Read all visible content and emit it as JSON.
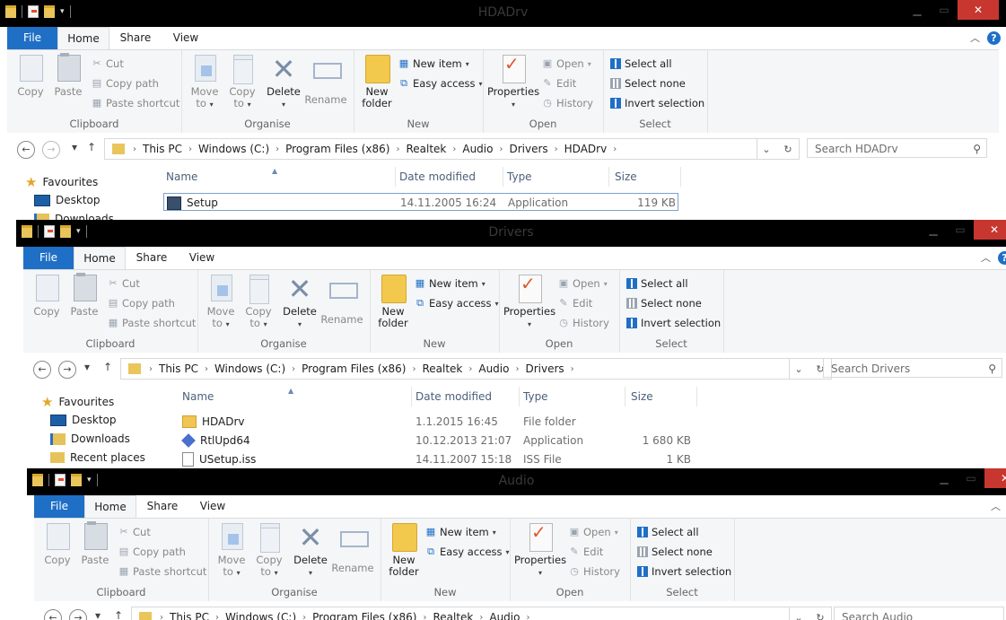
{
  "windows": [
    {
      "title": "HDADrv",
      "tabs": {
        "file": "File",
        "home": "Home",
        "share": "Share",
        "view": "View"
      },
      "ribbon": {
        "clipboard": {
          "label": "Clipboard",
          "copy": "Copy",
          "paste": "Paste",
          "cut": "Cut",
          "copy_path": "Copy path",
          "paste_shortcut": "Paste shortcut"
        },
        "organise": {
          "label": "Organise",
          "move_to": "Move to",
          "copy_to": "Copy to",
          "delete": "Delete",
          "rename": "Rename"
        },
        "new": {
          "label": "New",
          "new_folder": "New folder",
          "new_item": "New item",
          "easy_access": "Easy access"
        },
        "open": {
          "label": "Open",
          "properties": "Properties",
          "open": "Open",
          "edit": "Edit",
          "history": "History"
        },
        "select": {
          "label": "Select",
          "select_all": "Select all",
          "select_none": "Select none",
          "invert_selection": "Invert selection"
        }
      },
      "breadcrumbs": [
        "This PC",
        "Windows (C:)",
        "Program Files (x86)",
        "Realtek",
        "Audio",
        "Drivers",
        "HDADrv"
      ],
      "search_placeholder": "Search HDADrv",
      "nav": {
        "favourites": "Favourites",
        "desktop": "Desktop",
        "downloads": "Downloads"
      },
      "columns": {
        "name": "Name",
        "date": "Date modified",
        "type": "Type",
        "size": "Size"
      },
      "files": [
        {
          "name": "Setup",
          "date": "14.11.2005 16:24",
          "type": "Application",
          "size": "119 KB",
          "icon": "application-icon"
        }
      ]
    },
    {
      "title": "Drivers",
      "tabs": {
        "file": "File",
        "home": "Home",
        "share": "Share",
        "view": "View"
      },
      "ribbon": {
        "clipboard": {
          "label": "Clipboard",
          "copy": "Copy",
          "paste": "Paste",
          "cut": "Cut",
          "copy_path": "Copy path",
          "paste_shortcut": "Paste shortcut"
        },
        "organise": {
          "label": "Organise",
          "move_to": "Move to",
          "copy_to": "Copy to",
          "delete": "Delete",
          "rename": "Rename"
        },
        "new": {
          "label": "New",
          "new_folder": "New folder",
          "new_item": "New item",
          "easy_access": "Easy access"
        },
        "open": {
          "label": "Open",
          "properties": "Properties",
          "open": "Open",
          "edit": "Edit",
          "history": "History"
        },
        "select": {
          "label": "Select",
          "select_all": "Select all",
          "select_none": "Select none",
          "invert_selection": "Invert selection"
        }
      },
      "breadcrumbs": [
        "This PC",
        "Windows (C:)",
        "Program Files (x86)",
        "Realtek",
        "Audio",
        "Drivers"
      ],
      "search_placeholder": "Search Drivers",
      "nav": {
        "favourites": "Favourites",
        "desktop": "Desktop",
        "downloads": "Downloads",
        "recent_places": "Recent places"
      },
      "columns": {
        "name": "Name",
        "date": "Date modified",
        "type": "Type",
        "size": "Size"
      },
      "files": [
        {
          "name": "HDADrv",
          "date": "1.1.2015 16:45",
          "type": "File folder",
          "size": "",
          "icon": "folder-icon"
        },
        {
          "name": "RtlUpd64",
          "date": "10.12.2013 21:07",
          "type": "Application",
          "size": "1 680 KB",
          "icon": "application-icon"
        },
        {
          "name": "USetup.iss",
          "date": "14.11.2007 15:18",
          "type": "ISS File",
          "size": "1 KB",
          "icon": "file-icon"
        }
      ]
    },
    {
      "title": "Audio",
      "tabs": {
        "file": "File",
        "home": "Home",
        "share": "Share",
        "view": "View"
      },
      "ribbon": {
        "clipboard": {
          "label": "Clipboard",
          "copy": "Copy",
          "paste": "Paste",
          "cut": "Cut",
          "copy_path": "Copy path",
          "paste_shortcut": "Paste shortcut"
        },
        "organise": {
          "label": "Organise",
          "move_to": "Move to",
          "copy_to": "Copy to",
          "delete": "Delete",
          "rename": "Rename"
        },
        "new": {
          "label": "New",
          "new_folder": "New folder",
          "new_item": "New item",
          "easy_access": "Easy access"
        },
        "open": {
          "label": "Open",
          "properties": "Properties",
          "open": "Open",
          "edit": "Edit",
          "history": "History"
        },
        "select": {
          "label": "Select",
          "select_all": "Select all",
          "select_none": "Select none",
          "invert_selection": "Invert selection"
        }
      },
      "breadcrumbs": [
        "This PC",
        "Windows (C:)",
        "Program Files (x86)",
        "Realtek",
        "Audio"
      ],
      "search_placeholder": "Search Audio"
    }
  ],
  "colors": {
    "accent": "#1f6fc6",
    "titlebar": "#000000",
    "close": "#c7372f",
    "ribbon_bg": "#f5f6f7"
  }
}
